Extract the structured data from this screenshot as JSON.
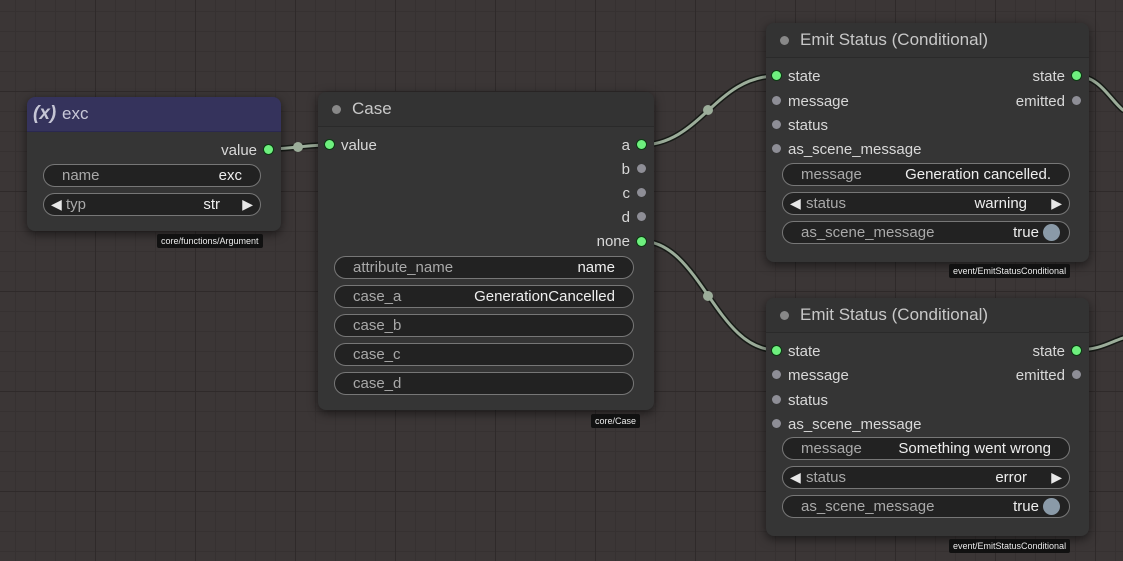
{
  "colors": {
    "canvas_bg": "#3b3636",
    "node_bg": "#353535",
    "argument_header": "#35335c",
    "wire": "#9cad9a",
    "connected_dot": "#6ef07e",
    "unconnected_dot": "#8e8e96"
  },
  "argument_node": {
    "title_icon": "(x)",
    "title": "exc",
    "output_label": "value",
    "widgets": [
      {
        "name": "name",
        "value": "exc"
      },
      {
        "name": "typ",
        "value": "str"
      }
    ],
    "badge": "core/functions/Argument"
  },
  "case_node": {
    "title": "Case",
    "input_label": "value",
    "outputs": [
      "a",
      "b",
      "c",
      "d",
      "none"
    ],
    "widgets": [
      {
        "name": "attribute_name",
        "value": "name"
      },
      {
        "name": "case_a",
        "value": "GenerationCancelled"
      },
      {
        "name": "case_b",
        "value": ""
      },
      {
        "name": "case_c",
        "value": ""
      },
      {
        "name": "case_d",
        "value": ""
      }
    ],
    "badge": "core/Case"
  },
  "emit_nodes": [
    {
      "title": "Emit Status (Conditional)",
      "inputs": [
        "state",
        "message",
        "status",
        "as_scene_message"
      ],
      "outputs": [
        "state",
        "emitted"
      ],
      "message_label": "message",
      "message_value": "Generation cancelled.",
      "status_label": "status",
      "status_value": "warning",
      "toggle_label": "as_scene_message",
      "toggle_value": "true",
      "badge": "event/EmitStatusConditional"
    },
    {
      "title": "Emit Status (Conditional)",
      "inputs": [
        "state",
        "message",
        "status",
        "as_scene_message"
      ],
      "outputs": [
        "state",
        "emitted"
      ],
      "message_label": "message",
      "message_value": "Something went wrong",
      "status_label": "status",
      "status_value": "error",
      "toggle_label": "as_scene_message",
      "toggle_value": "true",
      "badge": "event/EmitStatusConditional"
    }
  ]
}
